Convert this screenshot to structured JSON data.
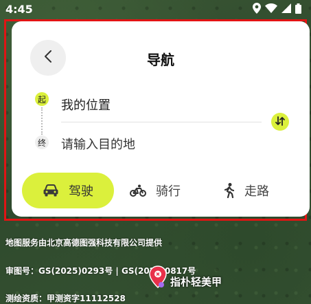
{
  "status_bar": {
    "time": "4:45",
    "icons": [
      "location-icon",
      "wifi-icon",
      "signal-icon",
      "battery-icon"
    ]
  },
  "nav_panel": {
    "title": "导航",
    "back_icon": "chevron-left-icon",
    "start": {
      "marker": "起",
      "label": "我的位置"
    },
    "end": {
      "marker": "终",
      "placeholder": "请输入目的地"
    },
    "swap_icon": "swap-vertical-icon",
    "modes": [
      {
        "label": "驾驶",
        "icon": "car-icon",
        "active": true
      },
      {
        "label": "骑行",
        "icon": "bicycle-icon",
        "active": false
      },
      {
        "label": "走路",
        "icon": "walk-icon",
        "active": false
      }
    ]
  },
  "map": {
    "provider_credit": "地图服务由北京高德图强科技有限公司提供",
    "approval_number": "审图号：GS(2025)0293号 | GS(2025)0817号",
    "survey_license": "测绘资质：甲测资字11112528",
    "poi_label": "指朴轻美甲",
    "poi_icon": "beauty-poi-icon"
  },
  "colors": {
    "accent": "#dbf03c",
    "highlight_border": "#e11414",
    "card_background": "#ffffff",
    "map_green": "#3a5634"
  }
}
